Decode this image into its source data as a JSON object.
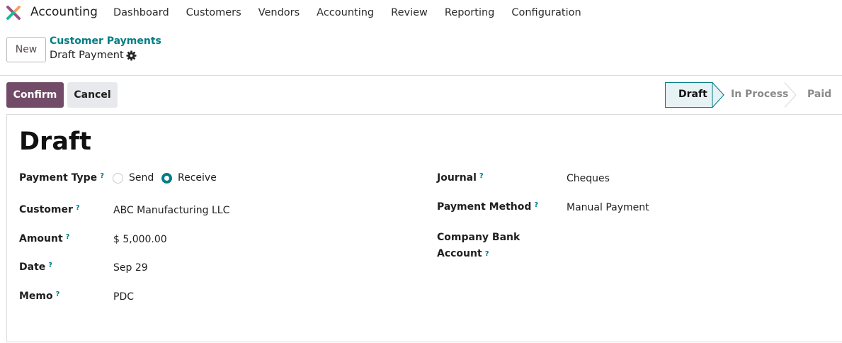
{
  "navbar": {
    "app_name": "Accounting",
    "items": [
      "Dashboard",
      "Customers",
      "Vendors",
      "Accounting",
      "Review",
      "Reporting",
      "Configuration"
    ]
  },
  "control_panel": {
    "new_label": "New",
    "breadcrumb_parent": "Customer Payments",
    "breadcrumb_current": "Draft Payment"
  },
  "actions": {
    "confirm_label": "Confirm",
    "cancel_label": "Cancel"
  },
  "statusbar": {
    "stages": [
      "Draft",
      "In Process",
      "Paid"
    ],
    "active": "Draft"
  },
  "form": {
    "title": "Draft",
    "help_mark": "?",
    "payment_type": {
      "label": "Payment Type",
      "options": [
        "Send",
        "Receive"
      ],
      "selected": "Receive"
    },
    "customer": {
      "label": "Customer",
      "value": "ABC Manufacturing LLC"
    },
    "amount": {
      "label": "Amount",
      "value": "$ 5,000.00"
    },
    "date": {
      "label": "Date",
      "value": "Sep 29"
    },
    "memo": {
      "label": "Memo",
      "value": "PDC"
    },
    "journal": {
      "label": "Journal",
      "value": "Cheques"
    },
    "payment_method": {
      "label": "Payment Method",
      "value": "Manual Payment"
    },
    "company_bank_account": {
      "label_line1": "Company Bank",
      "label_line2": "Account",
      "value": ""
    }
  },
  "colors": {
    "primary": "#714b67",
    "accent": "#017e84",
    "secondary_button": "#e7e9ed"
  }
}
